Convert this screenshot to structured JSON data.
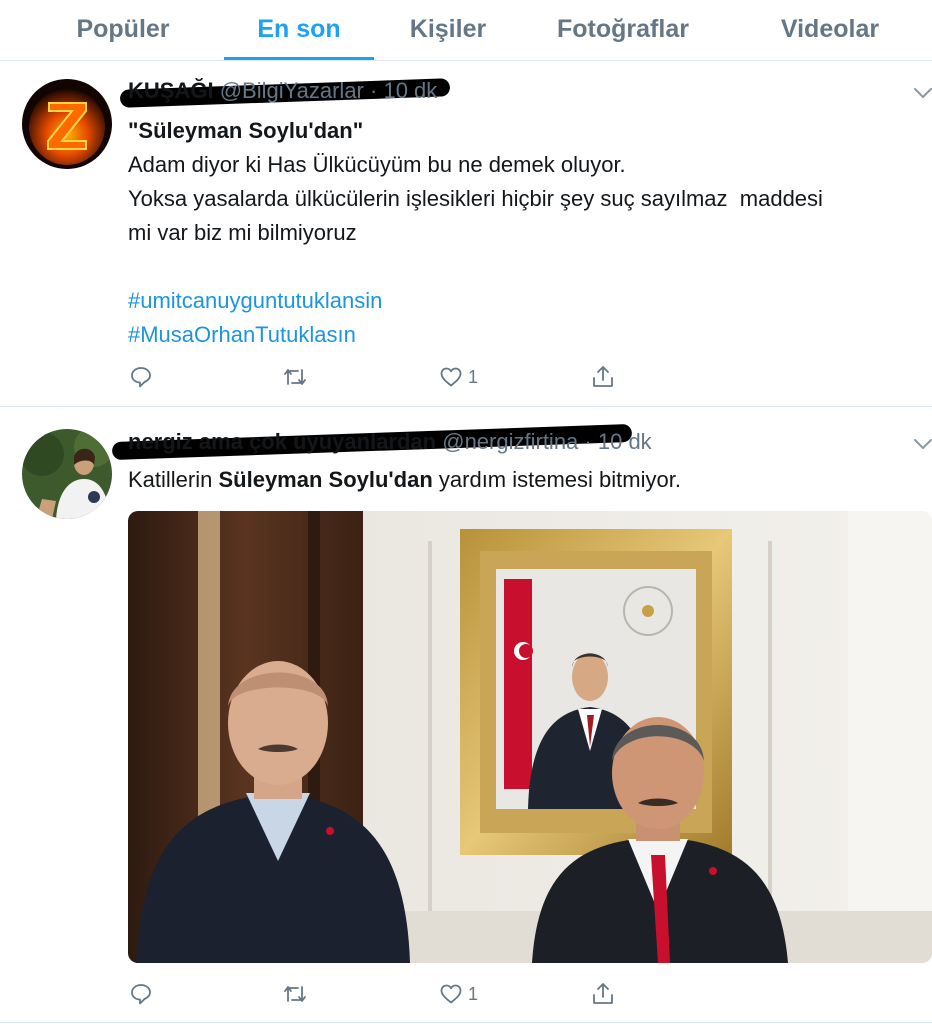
{
  "tabs": [
    {
      "label": "Popüler"
    },
    {
      "label": "En son"
    },
    {
      "label": "Kişiler"
    },
    {
      "label": "Fotoğraflar"
    },
    {
      "label": "Videolar"
    }
  ],
  "active_tab": "En son",
  "tweets": [
    {
      "display_name": "KUŞAĞI",
      "handle": "@BilgiYazarlar",
      "time": "· 10 dk",
      "title": "\"Süleyman Soylu'dan\"",
      "body_lines": [
        "Adam diyor ki Has Ülkücüyüm bu ne demek oluyor.",
        "Yoksa yasalarda ülkücülerin işlesikleri hiçbir şey suç sayılmaz  maddesi",
        "mi var biz mi bilmiyoruz"
      ],
      "hashtags": [
        "#umitcanuyguntutuklansin",
        "#MusaOrhanTutuklasın"
      ],
      "actions": {
        "reply": "",
        "retweet": "",
        "like": "1",
        "share": ""
      }
    },
    {
      "display_name": "nergiz ama çok uyuyanlardan",
      "handle": "@nergizfirtina",
      "time": "· 10 dk",
      "body_prefix": "Katillerin ",
      "body_bold": "Süleyman Soylu'dan",
      "body_suffix": " yardım istemesi bitmiyor.",
      "actions": {
        "reply": "",
        "retweet": "",
        "like": "1",
        "share": ""
      }
    }
  ],
  "colors": {
    "accent": "#1da1f2",
    "hashtag": "#1b95e0",
    "muted": "#657786",
    "text": "#14171a",
    "divider": "#e1e8ed"
  },
  "icons": [
    "reply-icon",
    "retweet-icon",
    "heart-icon",
    "share-icon",
    "chevron-down-icon"
  ]
}
